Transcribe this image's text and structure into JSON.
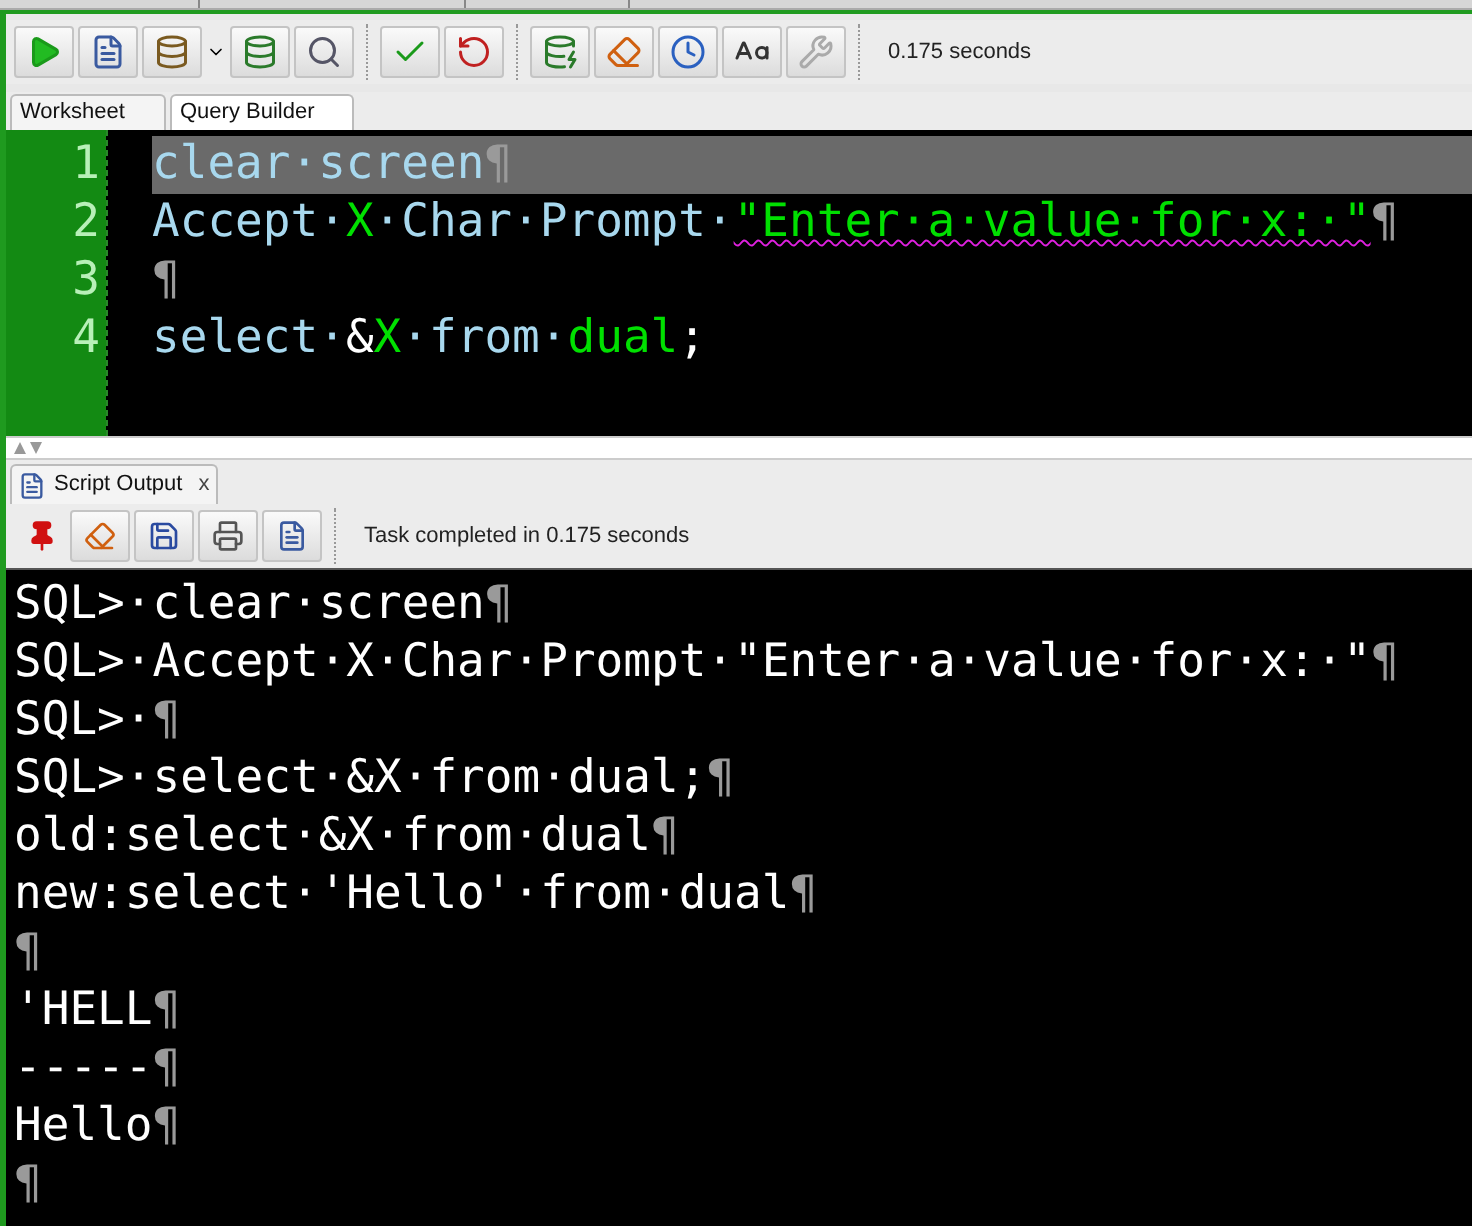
{
  "toolbar": {
    "status": "0.175 seconds"
  },
  "tabs": [
    {
      "label": "Worksheet",
      "selected": true
    },
    {
      "label": "Query Builder",
      "selected": false
    }
  ],
  "editor": {
    "lines": [
      {
        "number": "1",
        "selected": true,
        "tokens": [
          {
            "kind": "plain",
            "text": "clear·screen"
          },
          {
            "kind": "pilcrow",
            "text": "¶"
          }
        ]
      },
      {
        "number": "2",
        "selected": false,
        "tokens": [
          {
            "kind": "plain",
            "text": "Accept·"
          },
          {
            "kind": "literal",
            "text": "X"
          },
          {
            "kind": "plain",
            "text": "·Char·Prompt·"
          },
          {
            "kind": "literal",
            "text": "\"Enter·a·value·for·x:·\"",
            "spell_error": true
          },
          {
            "kind": "pilcrow",
            "text": "¶"
          }
        ]
      },
      {
        "number": "3",
        "selected": false,
        "tokens": [
          {
            "kind": "pilcrow",
            "text": "¶"
          }
        ]
      },
      {
        "number": "4",
        "selected": false,
        "tokens": [
          {
            "kind": "plain",
            "text": "select·"
          },
          {
            "kind": "symbol",
            "text": "&"
          },
          {
            "kind": "literal",
            "text": "X"
          },
          {
            "kind": "plain",
            "text": "·from·"
          },
          {
            "kind": "literal",
            "text": "dual"
          },
          {
            "kind": "symbol",
            "text": ";"
          }
        ]
      }
    ]
  },
  "output_panel": {
    "tab": {
      "label": "Script Output",
      "close": "x"
    },
    "status": "Task completed in 0.175 seconds",
    "lines": [
      {
        "text": "SQL>·clear·screen",
        "end": "¶"
      },
      {
        "text": "SQL>·Accept·X·Char·Prompt·\"Enter·a·value·for·x:·\"",
        "end": "¶"
      },
      {
        "text": "SQL>·",
        "end": "¶"
      },
      {
        "text": "SQL>·select·&X·from·dual;",
        "end": "¶"
      },
      {
        "text": "old:select·&X·from·dual",
        "end": "¶"
      },
      {
        "text": "new:select·'Hello'·from·dual",
        "end": "¶"
      },
      {
        "end": "¶"
      },
      {
        "text": "'HELL",
        "end": "¶"
      },
      {
        "text": "-----",
        "end": "¶"
      },
      {
        "text": "Hello",
        "end": "¶"
      },
      {
        "end": "¶"
      }
    ]
  }
}
